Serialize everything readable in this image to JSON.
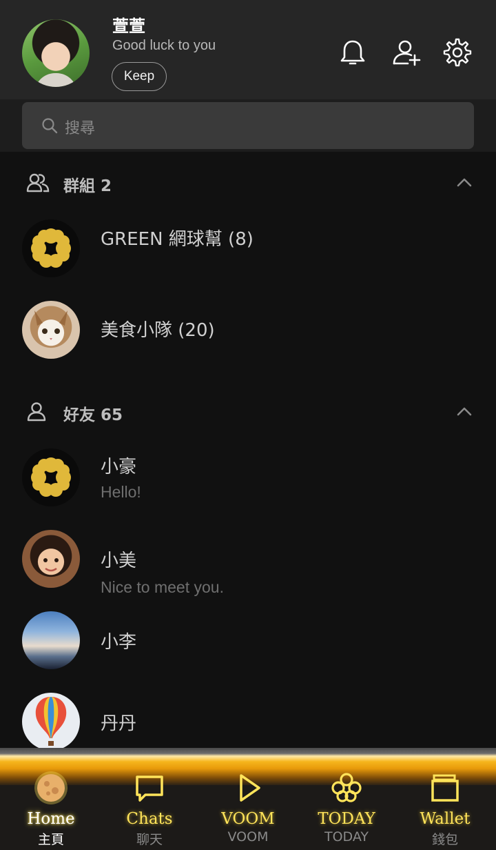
{
  "profile": {
    "name": "萱萱",
    "status": "Good luck to you",
    "keep_label": "Keep"
  },
  "header_icons": [
    "bell-icon",
    "add-friend-icon",
    "settings-icon"
  ],
  "search": {
    "placeholder": "搜尋"
  },
  "groups": {
    "label": "群組 2",
    "items": [
      {
        "name": "GREEN 網球幫 (8)",
        "avatar": "clover"
      },
      {
        "name": "美食小隊 (20)",
        "avatar": "cat"
      }
    ]
  },
  "friends": {
    "label": "好友 65",
    "items": [
      {
        "name": "小豪",
        "status": "Hello!",
        "avatar": "clover"
      },
      {
        "name": "小美",
        "status": "Nice to meet you.",
        "avatar": "woman"
      },
      {
        "name": "小李",
        "status": "",
        "avatar": "sky"
      },
      {
        "name": "丹丹",
        "status": "",
        "avatar": "balloon"
      }
    ]
  },
  "tabs": [
    {
      "en": "Home",
      "zh": "主頁",
      "icon": "moon-icon",
      "active": true
    },
    {
      "en": "Chats",
      "zh": "聊天",
      "icon": "chat-bubble-icon"
    },
    {
      "en": "VOOM",
      "zh": "VOOM",
      "icon": "play-icon"
    },
    {
      "en": "TODAY",
      "zh": "TODAY",
      "icon": "clover-icon"
    },
    {
      "en": "Wallet",
      "zh": "錢包",
      "icon": "wallet-icon"
    }
  ],
  "colors": {
    "background": "#111111",
    "header": "#262626",
    "accent_gold": "#ffe45a",
    "tab_glow": "#f6b51c"
  }
}
